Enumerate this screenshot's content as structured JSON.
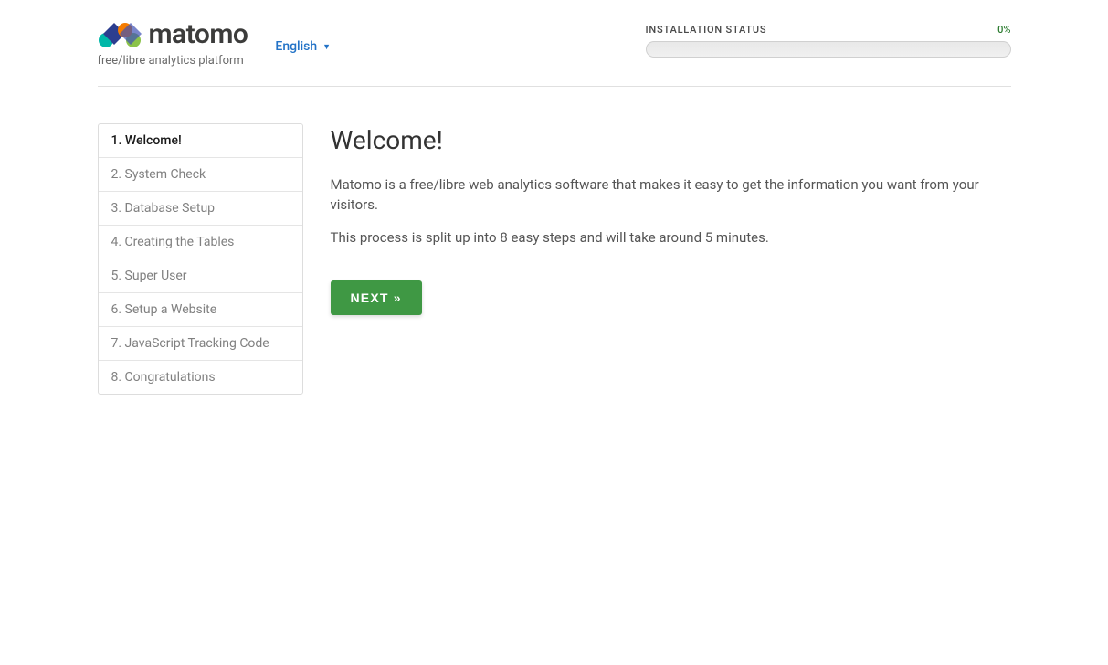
{
  "brand": {
    "name": "matomo",
    "tagline": "free/libre analytics platform"
  },
  "language": {
    "current": "English"
  },
  "status": {
    "label": "INSTALLATION STATUS",
    "percent": "0%"
  },
  "sidebar": {
    "steps": [
      {
        "label": "1. Welcome!",
        "active": true
      },
      {
        "label": "2. System Check",
        "active": false
      },
      {
        "label": "3. Database Setup",
        "active": false
      },
      {
        "label": "4. Creating the Tables",
        "active": false
      },
      {
        "label": "5. Super User",
        "active": false
      },
      {
        "label": "6. Setup a Website",
        "active": false
      },
      {
        "label": "7. JavaScript Tracking Code",
        "active": false
      },
      {
        "label": "8. Congratulations",
        "active": false
      }
    ]
  },
  "main": {
    "title": "Welcome!",
    "paragraph1": "Matomo is a free/libre web analytics software that makes it easy to get the information you want from your visitors.",
    "paragraph2": "This process is split up into 8 easy steps and will take around 5 minutes.",
    "next_button": "NEXT »"
  }
}
